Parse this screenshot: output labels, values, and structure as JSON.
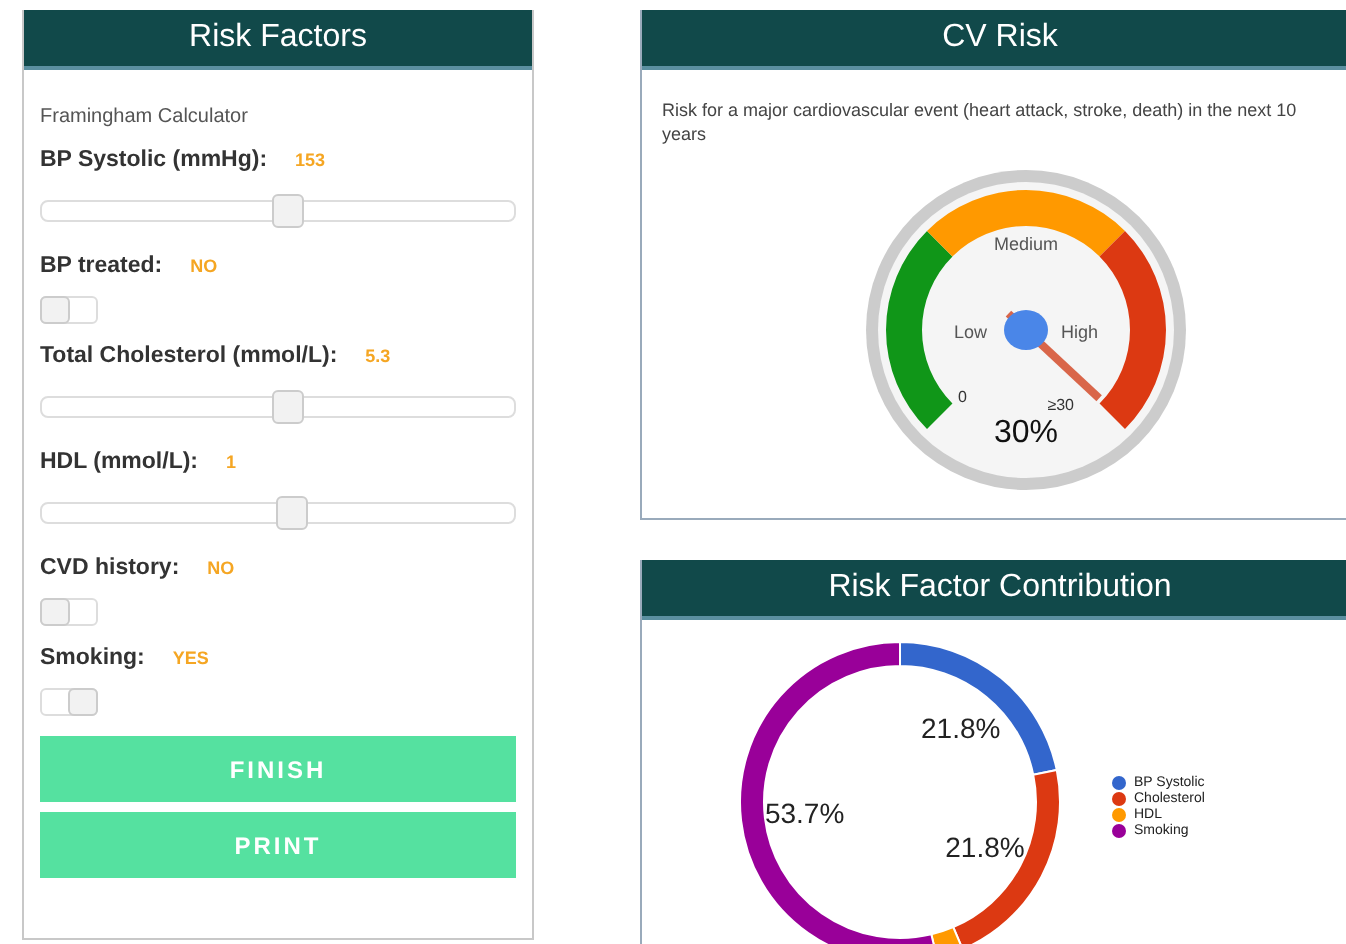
{
  "risk_factors": {
    "title": "Risk Factors",
    "subtitle": "Framingham Calculator",
    "inputs": [
      {
        "kind": "slider",
        "label": "BP Systolic (mmHg):",
        "value": "153",
        "level": 0.52
      },
      {
        "kind": "toggle",
        "label": "BP treated:",
        "value": "NO",
        "on": false
      },
      {
        "kind": "slider",
        "label": "Total Cholesterol (mmol/L):",
        "value": "5.3",
        "level": 0.52
      },
      {
        "kind": "slider",
        "label": "HDL (mmol/L):",
        "value": "1",
        "level": 0.53
      },
      {
        "kind": "toggle",
        "label": "CVD history:",
        "value": "NO",
        "on": false
      },
      {
        "kind": "toggle",
        "label": "Smoking:",
        "value": "YES",
        "on": true
      }
    ],
    "buttons": [
      "FINISH",
      "PRINT"
    ]
  },
  "cv_risk": {
    "title": "CV Risk",
    "description": "Risk for a major cardiovascular event (heart attack, stroke, death) in the next 10 years",
    "gauge": {
      "bands": [
        "Low",
        "Medium",
        "High"
      ],
      "min_label": "0",
      "max_label": "≥30",
      "reading": "30%"
    }
  },
  "contribution": {
    "title": "Risk Factor Contribution",
    "chart_data": {
      "type": "donut",
      "categories": [
        "BP Systolic",
        "Cholesterol",
        "HDL",
        "Smoking"
      ],
      "series": [
        {
          "values": [
            21.8,
            21.8,
            2.7,
            53.7
          ]
        }
      ],
      "colors": [
        "#3366cc",
        "#dc3912",
        "#ff9900",
        "#990099"
      ],
      "value_labels": [
        "21.8%",
        "21.8%",
        null,
        "53.7%"
      ]
    }
  }
}
